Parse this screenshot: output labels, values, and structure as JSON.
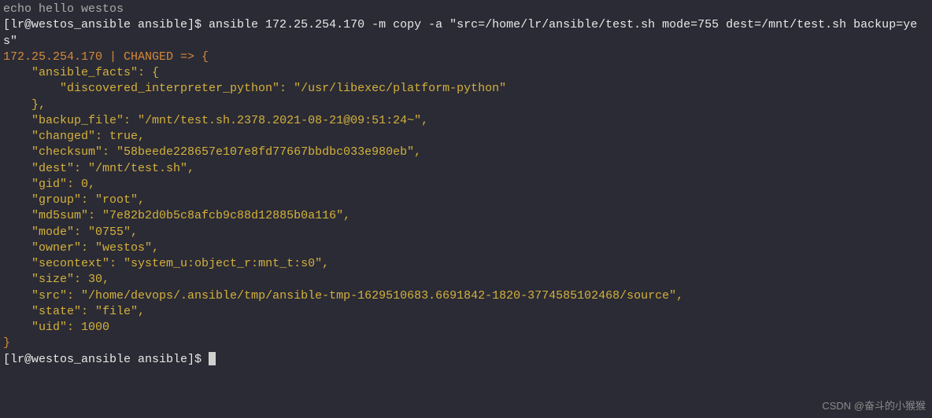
{
  "top_cut": "echo hello westos",
  "prompt1": "[lr@westos_ansible ansible]$ ",
  "cmd1": "ansible 172.25.254.170 -m copy -a \"src=/home/lr/ansible/test.sh mode=755 dest=/mnt/test.sh backup=yes\"",
  "result_header": "172.25.254.170 | CHANGED => {",
  "facts_open": "    \"ansible_facts\": {",
  "facts_interp": "        \"discovered_interpreter_python\": \"/usr/libexec/platform-python\"",
  "facts_close": "    },",
  "backup_file": "    \"backup_file\": \"/mnt/test.sh.2378.2021-08-21@09:51:24~\",",
  "changed": "    \"changed\": true,",
  "checksum": "    \"checksum\": \"58beede228657e107e8fd77667bbdbc033e980eb\",",
  "dest": "    \"dest\": \"/mnt/test.sh\",",
  "gid": "    \"gid\": 0,",
  "group": "    \"group\": \"root\",",
  "md5sum": "    \"md5sum\": \"7e82b2d0b5c8afcb9c88d12885b0a116\",",
  "mode": "    \"mode\": \"0755\",",
  "owner": "    \"owner\": \"westos\",",
  "secontext": "    \"secontext\": \"system_u:object_r:mnt_t:s0\",",
  "size": "    \"size\": 30,",
  "src": "    \"src\": \"/home/devops/.ansible/tmp/ansible-tmp-1629510683.6691842-1820-3774585102468/source\",",
  "state": "    \"state\": \"file\",",
  "uid": "    \"uid\": 1000",
  "close_brace": "}",
  "prompt2": "[lr@westos_ansible ansible]$ ",
  "watermark": "CSDN @奋斗的小猴猴"
}
